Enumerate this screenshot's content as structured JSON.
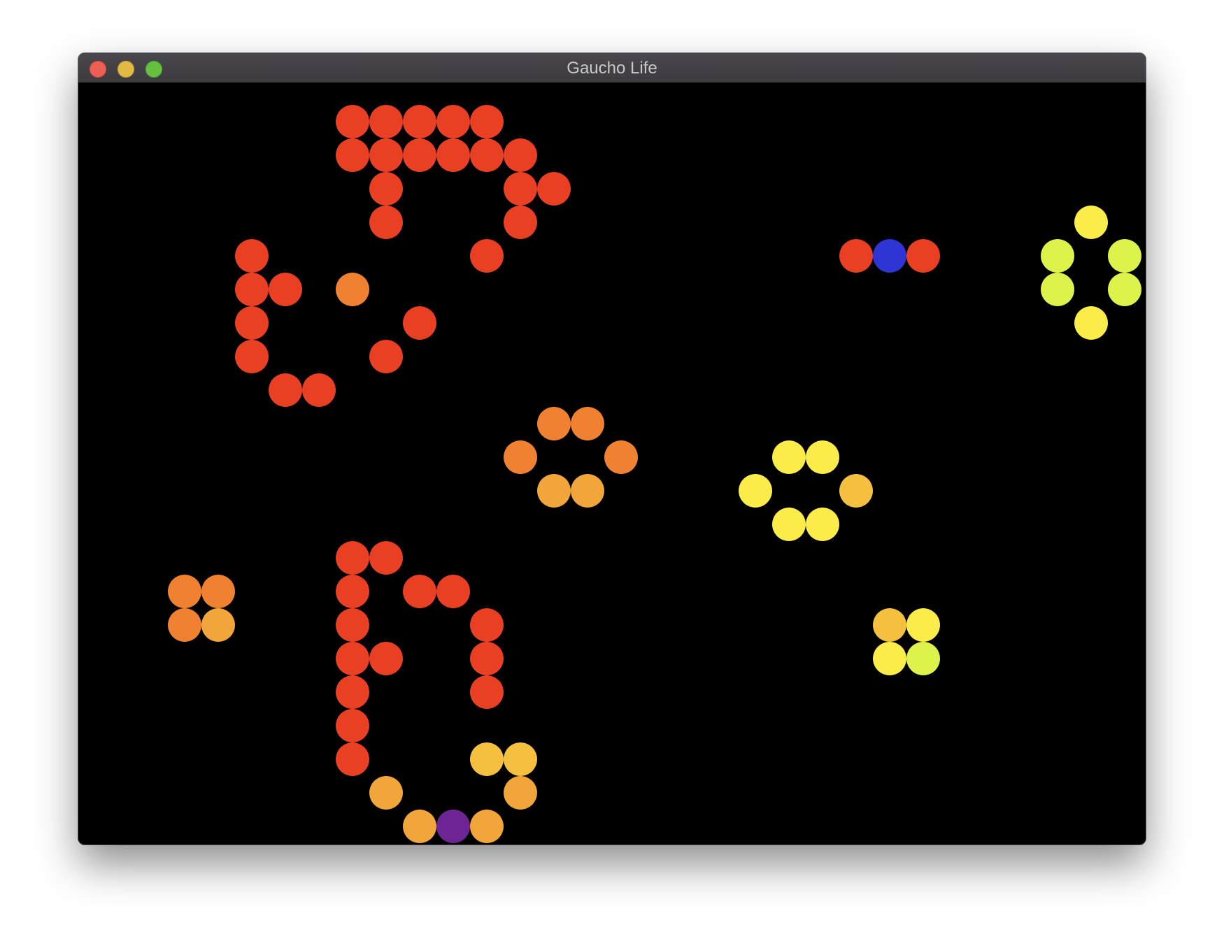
{
  "window": {
    "title": "Gaucho Life",
    "buttons": {
      "close": "close",
      "minimize": "minimize",
      "zoom": "zoom"
    }
  },
  "colors": {
    "red": "#e94023",
    "orange": "#ef8130",
    "amber": "#f2a53a",
    "gold": "#f5c040",
    "yellow": "#fbec4a",
    "lime": "#def24c",
    "blue": "#2f35d4",
    "purple": "#6d2596"
  },
  "board": {
    "live_cells": [
      {
        "row": 0,
        "col": 7,
        "color": "red"
      },
      {
        "row": 0,
        "col": 8,
        "color": "red"
      },
      {
        "row": 0,
        "col": 9,
        "color": "red"
      },
      {
        "row": 0,
        "col": 10,
        "color": "red"
      },
      {
        "row": 0,
        "col": 11,
        "color": "red"
      },
      {
        "row": 1,
        "col": 7,
        "color": "red"
      },
      {
        "row": 1,
        "col": 8,
        "color": "red"
      },
      {
        "row": 1,
        "col": 9,
        "color": "red"
      },
      {
        "row": 1,
        "col": 10,
        "color": "red"
      },
      {
        "row": 1,
        "col": 11,
        "color": "red"
      },
      {
        "row": 1,
        "col": 12,
        "color": "red"
      },
      {
        "row": 2,
        "col": 8,
        "color": "red"
      },
      {
        "row": 2,
        "col": 12,
        "color": "red"
      },
      {
        "row": 2,
        "col": 13,
        "color": "red"
      },
      {
        "row": 3,
        "col": 8,
        "color": "red"
      },
      {
        "row": 3,
        "col": 12,
        "color": "red"
      },
      {
        "row": 3,
        "col": 29,
        "color": "yellow"
      },
      {
        "row": 4,
        "col": 4,
        "color": "red"
      },
      {
        "row": 4,
        "col": 11,
        "color": "red"
      },
      {
        "row": 4,
        "col": 22,
        "color": "red"
      },
      {
        "row": 4,
        "col": 23,
        "color": "blue"
      },
      {
        "row": 4,
        "col": 24,
        "color": "red"
      },
      {
        "row": 4,
        "col": 28,
        "color": "lime"
      },
      {
        "row": 4,
        "col": 30,
        "color": "lime"
      },
      {
        "row": 5,
        "col": 4,
        "color": "red"
      },
      {
        "row": 5,
        "col": 5,
        "color": "red"
      },
      {
        "row": 5,
        "col": 7,
        "color": "orange"
      },
      {
        "row": 5,
        "col": 28,
        "color": "lime"
      },
      {
        "row": 5,
        "col": 30,
        "color": "lime"
      },
      {
        "row": 6,
        "col": 4,
        "color": "red"
      },
      {
        "row": 6,
        "col": 9,
        "color": "red"
      },
      {
        "row": 6,
        "col": 29,
        "color": "yellow"
      },
      {
        "row": 7,
        "col": 4,
        "color": "red"
      },
      {
        "row": 7,
        "col": 8,
        "color": "red"
      },
      {
        "row": 8,
        "col": 5,
        "color": "red"
      },
      {
        "row": 8,
        "col": 6,
        "color": "red"
      },
      {
        "row": 9,
        "col": 13,
        "color": "orange"
      },
      {
        "row": 9,
        "col": 14,
        "color": "orange"
      },
      {
        "row": 10,
        "col": 12,
        "color": "orange"
      },
      {
        "row": 10,
        "col": 15,
        "color": "orange"
      },
      {
        "row": 10,
        "col": 20,
        "color": "yellow"
      },
      {
        "row": 10,
        "col": 21,
        "color": "yellow"
      },
      {
        "row": 11,
        "col": 13,
        "color": "amber"
      },
      {
        "row": 11,
        "col": 14,
        "color": "amber"
      },
      {
        "row": 11,
        "col": 19,
        "color": "yellow"
      },
      {
        "row": 11,
        "col": 22,
        "color": "gold"
      },
      {
        "row": 12,
        "col": 20,
        "color": "yellow"
      },
      {
        "row": 12,
        "col": 21,
        "color": "yellow"
      },
      {
        "row": 13,
        "col": 7,
        "color": "red"
      },
      {
        "row": 13,
        "col": 8,
        "color": "red"
      },
      {
        "row": 14,
        "col": 2,
        "color": "orange"
      },
      {
        "row": 14,
        "col": 3,
        "color": "orange"
      },
      {
        "row": 14,
        "col": 7,
        "color": "red"
      },
      {
        "row": 14,
        "col": 9,
        "color": "red"
      },
      {
        "row": 14,
        "col": 10,
        "color": "red"
      },
      {
        "row": 15,
        "col": 2,
        "color": "orange"
      },
      {
        "row": 15,
        "col": 3,
        "color": "amber"
      },
      {
        "row": 15,
        "col": 7,
        "color": "red"
      },
      {
        "row": 15,
        "col": 11,
        "color": "red"
      },
      {
        "row": 15,
        "col": 23,
        "color": "gold"
      },
      {
        "row": 15,
        "col": 24,
        "color": "yellow"
      },
      {
        "row": 16,
        "col": 7,
        "color": "red"
      },
      {
        "row": 16,
        "col": 8,
        "color": "red"
      },
      {
        "row": 16,
        "col": 11,
        "color": "red"
      },
      {
        "row": 16,
        "col": 23,
        "color": "yellow"
      },
      {
        "row": 16,
        "col": 24,
        "color": "lime"
      },
      {
        "row": 17,
        "col": 7,
        "color": "red"
      },
      {
        "row": 17,
        "col": 11,
        "color": "red"
      },
      {
        "row": 18,
        "col": 7,
        "color": "red"
      },
      {
        "row": 19,
        "col": 7,
        "color": "red"
      },
      {
        "row": 19,
        "col": 11,
        "color": "gold"
      },
      {
        "row": 19,
        "col": 12,
        "color": "gold"
      },
      {
        "row": 20,
        "col": 8,
        "color": "amber"
      },
      {
        "row": 20,
        "col": 12,
        "color": "amber"
      },
      {
        "row": 21,
        "col": 9,
        "color": "amber"
      },
      {
        "row": 21,
        "col": 10,
        "color": "purple"
      },
      {
        "row": 21,
        "col": 11,
        "color": "amber"
      }
    ]
  }
}
